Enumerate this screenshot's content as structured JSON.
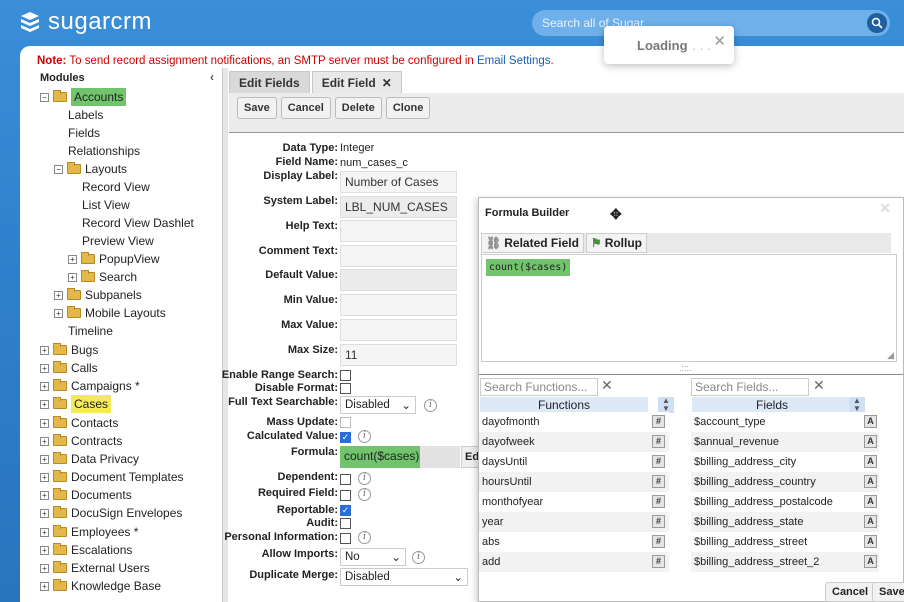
{
  "header": {
    "brand": "sugarcrm",
    "search_placeholder": "Search all of Sugar",
    "loading_label": "Loading",
    "loading_dots": ". . ."
  },
  "notice": {
    "prefix": "Note:",
    "text": " To send record assignment notifications, an SMTP server must be configured in ",
    "link": "Email Settings",
    "suffix": "."
  },
  "tree": {
    "title": "Modules",
    "items": [
      {
        "label": "Accounts"
      },
      {
        "label": "Labels"
      },
      {
        "label": "Fields"
      },
      {
        "label": "Relationships"
      },
      {
        "label": "Layouts"
      },
      {
        "label": "Record View"
      },
      {
        "label": "List View"
      },
      {
        "label": "Record View Dashlet"
      },
      {
        "label": "Preview View"
      },
      {
        "label": "PopupView"
      },
      {
        "label": "Search"
      },
      {
        "label": "Subpanels"
      },
      {
        "label": "Mobile Layouts"
      },
      {
        "label": "Timeline"
      },
      {
        "label": "Bugs"
      },
      {
        "label": "Calls"
      },
      {
        "label": "Campaigns *"
      },
      {
        "label": "Cases"
      },
      {
        "label": "Contacts"
      },
      {
        "label": "Contracts"
      },
      {
        "label": "Data Privacy"
      },
      {
        "label": "Document Templates"
      },
      {
        "label": "Documents"
      },
      {
        "label": "DocuSign Envelopes"
      },
      {
        "label": "Employees *"
      },
      {
        "label": "Escalations"
      },
      {
        "label": "External Users"
      },
      {
        "label": "Knowledge Base"
      }
    ]
  },
  "tabs": {
    "edit_fields": "Edit Fields",
    "edit_field": "Edit Field"
  },
  "buttons": {
    "save": "Save",
    "cancel": "Cancel",
    "delete": "Delete",
    "clone": "Clone"
  },
  "form": {
    "data_type_label": "Data Type:",
    "data_type": "Integer",
    "field_name_label": "Field Name:",
    "field_name": "num_cases_c",
    "display_label_label": "Display Label:",
    "display_label": "Number of Cases",
    "system_label_label": "System Label:",
    "system_label": "LBL_NUM_CASES",
    "help_text_label": "Help Text:",
    "comment_text_label": "Comment Text:",
    "default_value_label": "Default Value:",
    "min_value_label": "Min Value:",
    "max_value_label": "Max Value:",
    "max_size_label": "Max Size:",
    "max_size": "11",
    "enable_range_label": "Enable Range Search:",
    "disable_format_label": "Disable Format:",
    "full_text_label": "Full Text Searchable:",
    "full_text": "Disabled",
    "mass_update_label": "Mass Update:",
    "calculated_label": "Calculated Value:",
    "formula_label": "Formula:",
    "formula": "count($cases)",
    "edit_stub": "Ed",
    "dependent_label": "Dependent:",
    "required_label": "Required Field:",
    "reportable_label": "Reportable:",
    "audit_label": "Audit:",
    "personal_info_label": "Personal Information:",
    "allow_imports_label": "Allow Imports:",
    "allow_imports": "No",
    "duplicate_merge_label": "Duplicate Merge:",
    "duplicate_merge": "Disabled"
  },
  "formula_builder": {
    "title": "Formula Builder",
    "tab_related": "Related Field",
    "tab_rollup": "Rollup",
    "expression": "count($cases)",
    "search_functions_placeholder": "Search Functions...",
    "search_fields_placeholder": "Search Fields...",
    "functions_header": "Functions",
    "fields_header": "Fields",
    "functions": [
      "dayofmonth",
      "dayofweek",
      "daysUntil",
      "hoursUntil",
      "monthofyear",
      "year",
      "abs",
      "add"
    ],
    "function_badge": "#",
    "fields": [
      "$account_type",
      "$annual_revenue",
      "$billing_address_city",
      "$billing_address_country",
      "$billing_address_postalcode",
      "$billing_address_state",
      "$billing_address_street",
      "$billing_address_street_2"
    ],
    "field_badge": "A",
    "cancel": "Cancel",
    "save": "Save"
  },
  "colors": {
    "highlight_green": "#71c46c",
    "highlight_yellow": "#f3ea5b",
    "brand_blue": "#2f80cc"
  }
}
